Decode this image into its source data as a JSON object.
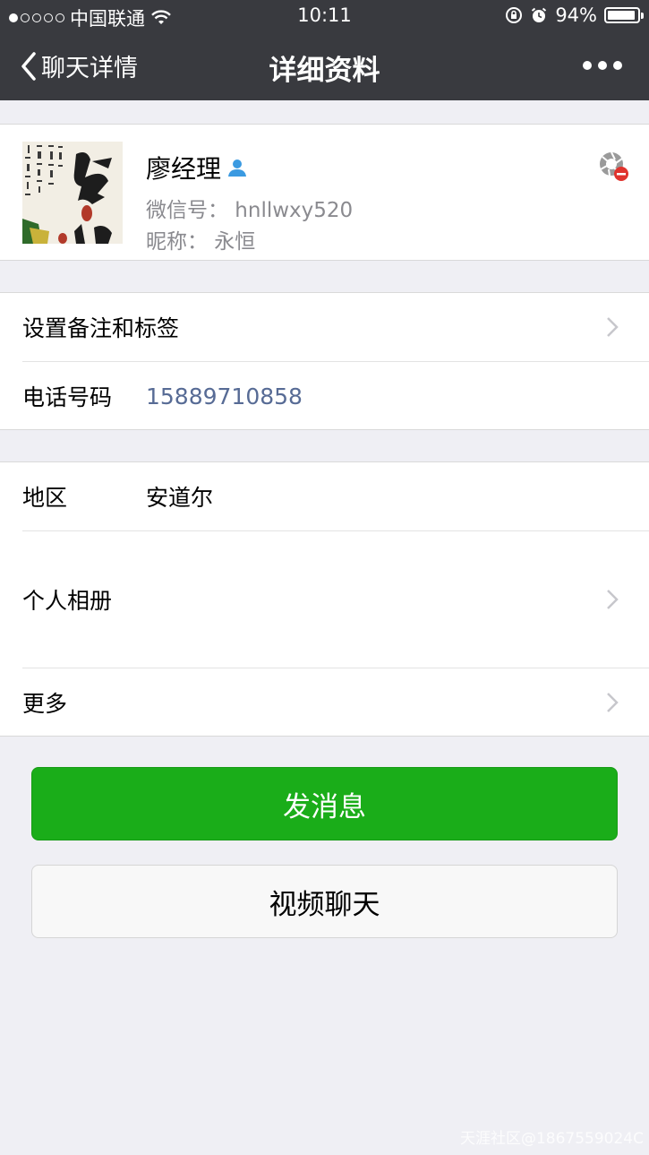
{
  "status_bar": {
    "carrier": "中国联通",
    "time": "10:11",
    "battery": "94%",
    "battery_level": 0.94,
    "signal_dots_filled": 1,
    "signal_dots_total": 5
  },
  "nav": {
    "back_label": "聊天详情",
    "title": "详细资料"
  },
  "profile": {
    "name": "廖经理",
    "wechat_id": "微信号：  hnllwxy520",
    "nickname": "昵称：  永恒"
  },
  "rows": {
    "remark": {
      "label": "设置备注和标签"
    },
    "phone": {
      "label": "电话号码",
      "value": "15889710858"
    },
    "region": {
      "label": "地区",
      "value": "安道尔"
    },
    "album": {
      "label": "个人相册"
    },
    "more": {
      "label": "更多"
    }
  },
  "buttons": {
    "send_message": "发消息",
    "video_chat": "视频聊天"
  },
  "watermark": "天涯社区@1867559024C",
  "colors": {
    "nav_bg": "#393a3f",
    "page_bg": "#efeff4",
    "accent_green": "#1aad19",
    "link_blue": "#576b95"
  },
  "icons": {
    "back": "chevron-left-icon",
    "more": "more-dots-icon",
    "user_badge": "user-icon",
    "lens": "camera-aperture-icon",
    "wifi": "wifi-icon",
    "lock": "rotation-lock-icon",
    "alarm": "alarm-icon"
  }
}
